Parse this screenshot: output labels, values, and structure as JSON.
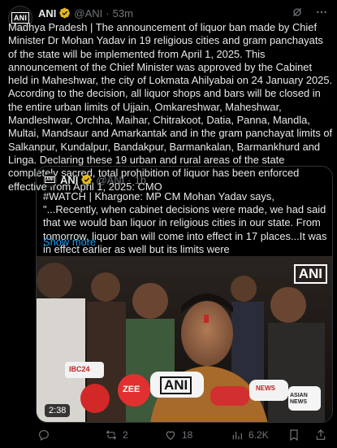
{
  "post": {
    "author_name": "ANI",
    "handle": "@ANI",
    "separator": "·",
    "time": "53m",
    "avatar_text": "ANI",
    "body": "Madhya Pradesh | The announcement of liquor ban made by Chief Minister Dr Mohan Yadav in 19 religious cities and gram panchayats of the state will be implemented from April 1, 2025. This announcement of the Chief Minister was approved by the Cabinet held in Maheshwar, the city of Lokmata Ahilyabai on 24 January 2025. According to the decision, all liquor shops and bars will be closed in the entire urban limits of Ujjain, Omkareshwar, Maheshwar, Mandleshwar, Orchha, Maihar, Chitrakoot, Datia, Panna, Mandla, Multai, Mandsaur and Amarkantak and in the gram panchayat limits of Salkanpur, Kundalpur, Bandakpur, Barmankalan, Barmankhurd and Linga. Declaring these 19 urban and rural areas of the state completely sacred, total prohibition of liquor has been enforced effective from April 1, 2025: CMO"
  },
  "quote": {
    "author_name": "ANI",
    "handle": "@ANI",
    "separator": "·",
    "time": "1h",
    "avatar_text": "ANI",
    "text": "#WATCH | Khargone: MP CM Mohan Yadav says, \"...Recently, when cabinet decisions were made, we had said that we would ban liquor in religious cities in our state. From tomorrow, liquor ban will come into effect in 17 places...It was in effect earlier as well but its limits were",
    "show_more": "Show more",
    "video": {
      "duration": "2:38",
      "watermark": "ANI",
      "mic_labels": [
        "IBC24",
        "ZEE",
        "ANI",
        "NEWS",
        "ASIAN NEWS"
      ]
    }
  },
  "footer": {
    "reply_count": "",
    "repost_count": "2",
    "like_count": "18",
    "views_count": "6.2K"
  },
  "colors": {
    "background": "#000000",
    "text": "#e7e9ea",
    "muted": "#71767b",
    "link": "#1d9bf0",
    "border": "#2f3336",
    "verified_gold": "#e2b719"
  }
}
